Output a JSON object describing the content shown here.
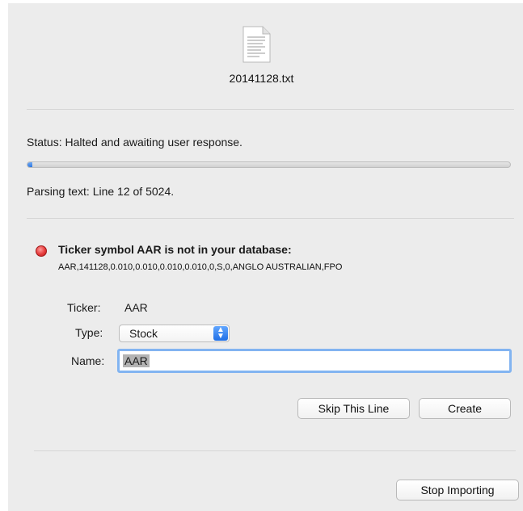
{
  "file": {
    "name": "20141128.txt",
    "icon": "text-file-icon"
  },
  "status": {
    "text": "Status:  Halted and awaiting user response.",
    "progress": 0.004
  },
  "parsing": {
    "text": "Parsing text: Line 12 of 5024."
  },
  "alert": {
    "icon": "red-alert-icon",
    "title": "Ticker symbol AAR is not in your database:",
    "line": "AAR,141128,0.010,0.010,0.010,0.010,0,S,0,ANGLO AUSTRALIAN,FPO"
  },
  "form": {
    "ticker_label": "Ticker:",
    "ticker_value": "AAR",
    "type_label": "Type:",
    "type_value": "Stock",
    "name_label": "Name:",
    "name_value": "AAR"
  },
  "buttons": {
    "skip": "Skip This Line",
    "create": "Create",
    "stop": "Stop Importing"
  },
  "colors": {
    "accent": "#2f78e0",
    "panel": "#ececec",
    "alert": "#e53b3b"
  }
}
